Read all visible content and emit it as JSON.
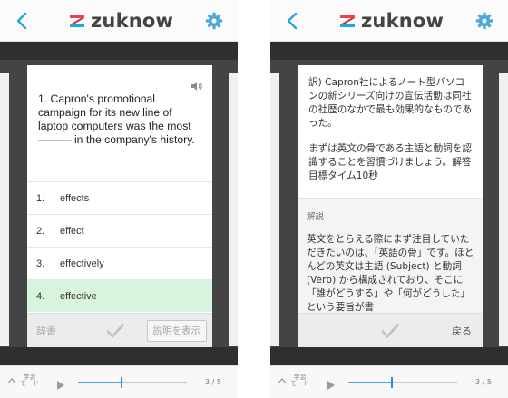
{
  "colors": {
    "brand_red": "#e8434c",
    "brand_blue": "#1ea9e0",
    "back_arrow": "#2aa4de",
    "gear": "#4aa6dc",
    "selected_option": "#d8f4dc",
    "slider_active": "#2d8bd8"
  },
  "icons": {
    "back": "chevron-left",
    "settings": "gear",
    "audio": "speaker",
    "mark": "checkmark",
    "mode": "chevron-up",
    "play": "play-triangle"
  },
  "app": {
    "name": "zuknow"
  },
  "screen_left": {
    "question": "1. Capron's promotional campaign for its new line of laptop computers was the most ——— in the company's history.",
    "options": [
      {
        "number": "1.",
        "text": "effects",
        "selected": false
      },
      {
        "number": "2.",
        "text": "effect",
        "selected": false
      },
      {
        "number": "3.",
        "text": "effectively",
        "selected": false
      },
      {
        "number": "4.",
        "text": "effective",
        "selected": true
      }
    ],
    "toolbar": {
      "dictionary_label": "辞書",
      "explain_label": "説明を表示"
    }
  },
  "screen_right": {
    "translation": "訳) Capron社によるノート型パソコンの新シリーズ向けの宣伝活動は同社の社歴のなかで最も効果的なものであった。",
    "tip": "まずは英文の骨である主語と動詞を認識することを習慣づけましょう。解答目標タイム10秒",
    "explanation_heading": "解説",
    "explanation_body": "英文をとらえる際にまず注目していただきたいのは、「英語の骨」です。ほとんどの英文は主語 (Subject) と動詞 (Verb) から構成されており、そこに「誰がどうする」や「何がどうした」という要旨が書",
    "toolbar": {
      "back_label": "戻る"
    }
  },
  "footer": {
    "mode_label_line1": "学習",
    "mode_label_line2": "モード",
    "progress_fraction": 0.4,
    "page_count": "3 / 5"
  }
}
